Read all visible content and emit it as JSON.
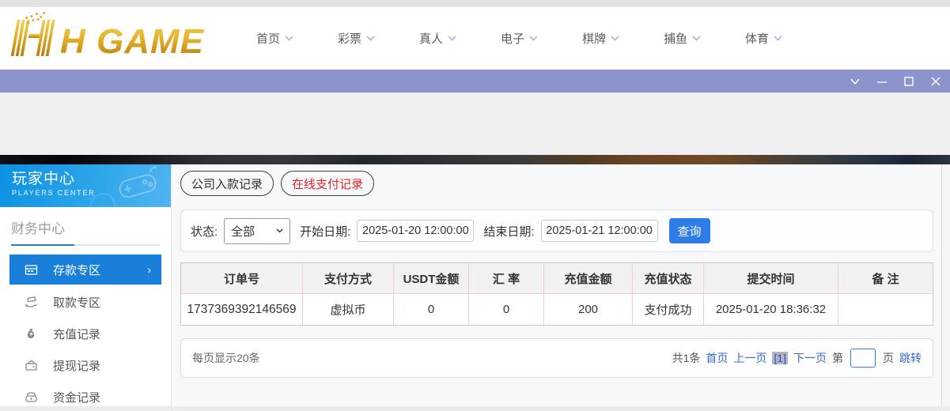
{
  "header": {
    "logo_text": "H GAME",
    "nav": [
      {
        "label": "首页"
      },
      {
        "label": "彩票"
      },
      {
        "label": "真人"
      },
      {
        "label": "电子"
      },
      {
        "label": "棋牌"
      },
      {
        "label": "捕鱼"
      },
      {
        "label": "体育"
      }
    ]
  },
  "titlebar": {
    "window_controls": [
      "collapse",
      "minimize",
      "maximize",
      "close"
    ]
  },
  "sidebar": {
    "title": "玩家中心",
    "subtitle": "PLAYERS CENTER",
    "section_title": "财务中心",
    "menu": [
      {
        "label": "存款专区",
        "icon": "deposit-icon",
        "active": true
      },
      {
        "label": "取款专区",
        "icon": "withdraw-icon",
        "active": false
      },
      {
        "label": "充值记录",
        "icon": "recharge-record-icon",
        "active": false
      },
      {
        "label": "提现记录",
        "icon": "withdrawal-record-icon",
        "active": false
      },
      {
        "label": "资金记录",
        "icon": "funds-record-icon",
        "active": false
      }
    ]
  },
  "main": {
    "tabs": [
      {
        "label": "公司入款记录",
        "active": false
      },
      {
        "label": "在线支付记录",
        "active": true
      }
    ],
    "filters": {
      "status_label": "状态:",
      "status_value": "全部",
      "start_label": "开始日期:",
      "start_value": "2025-01-20 12:00:00",
      "end_label": "结束日期:",
      "end_value": "2025-01-21 12:00:00",
      "search_button": "查询"
    },
    "table": {
      "headers": [
        "订单号",
        "支付方式",
        "USDT金额",
        "汇 率",
        "充值金额",
        "充值状态",
        "提交时间",
        "备 注"
      ],
      "rows": [
        [
          "1737369392146569",
          "虚拟币",
          "0",
          "0",
          "200",
          "支付成功",
          "2025-01-20 18:36:32",
          ""
        ]
      ]
    },
    "pagination": {
      "page_size_text": "每页显示20条",
      "total_text": "共1条",
      "first_label": "首页",
      "prev_label": "上一页",
      "current_page_label": "[1]",
      "next_label": "下一页",
      "jump_prefix": "第",
      "jump_suffix": "页",
      "jump_button": "跳转",
      "jump_value": ""
    }
  },
  "colors": {
    "accent_blue": "#1a7fd8",
    "button_blue": "#2e7ce8",
    "link_blue": "#3567d6",
    "tab_active_red": "#e5252c",
    "titlebar_purple": "#8b94cb",
    "logo_gold": "#d89a18",
    "table_border_pink": "#f0cfcf"
  }
}
